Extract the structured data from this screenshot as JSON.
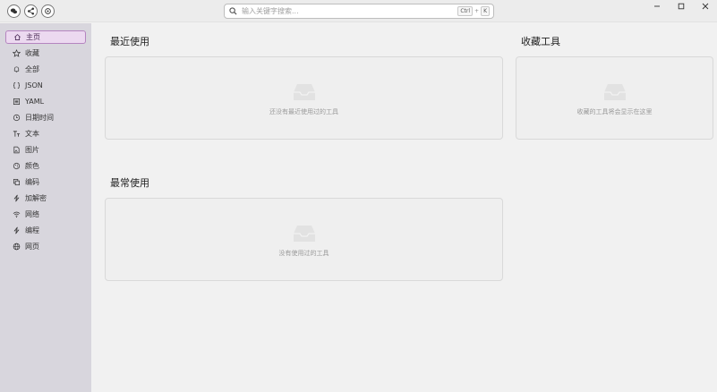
{
  "search": {
    "placeholder": "输入关键字搜索...",
    "key1": "Ctrl",
    "plus": "+",
    "key2": "K"
  },
  "sidebar": {
    "items": [
      {
        "label": "主页",
        "icon": "home-icon",
        "active": true
      },
      {
        "label": "收藏",
        "icon": "star-icon"
      },
      {
        "label": "全部",
        "icon": "bell-icon"
      },
      {
        "label": "JSON",
        "icon": "json-icon"
      },
      {
        "label": "YAML",
        "icon": "yaml-icon"
      },
      {
        "label": "日期时间",
        "icon": "clock-icon"
      },
      {
        "label": "文本",
        "icon": "text-icon"
      },
      {
        "label": "图片",
        "icon": "image-icon"
      },
      {
        "label": "颜色",
        "icon": "palette-icon"
      },
      {
        "label": "编码",
        "icon": "copy-icon"
      },
      {
        "label": "加解密",
        "icon": "bolt-icon"
      },
      {
        "label": "网络",
        "icon": "wifi-icon"
      },
      {
        "label": "编程",
        "icon": "bolt-icon"
      },
      {
        "label": "网页",
        "icon": "globe-icon"
      }
    ]
  },
  "main": {
    "recent": {
      "title": "最近使用",
      "empty": "还没有最近使用过的工具"
    },
    "favorites": {
      "title": "收藏工具",
      "empty": "收藏的工具将会显示在这里"
    },
    "frequent": {
      "title": "最常使用",
      "empty": "没有使用过的工具"
    }
  }
}
